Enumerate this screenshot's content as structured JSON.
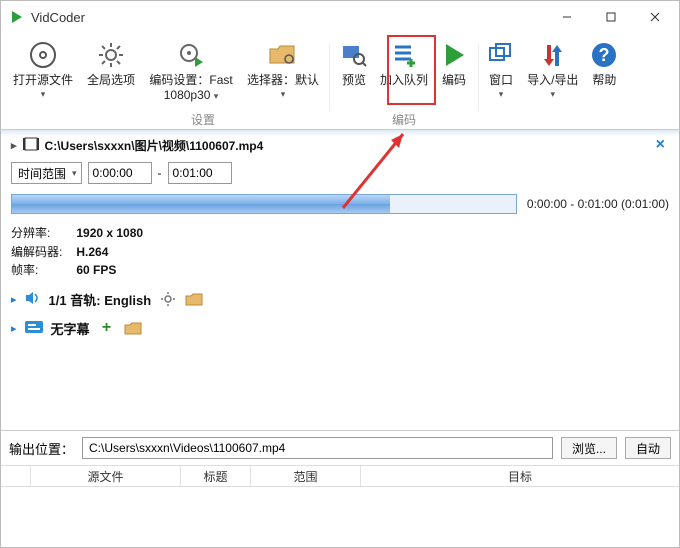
{
  "window": {
    "title": "VidCoder"
  },
  "toolbar": {
    "open_source": "打开源文件",
    "global_opts": "全局选项",
    "encode_settings_l1": "编码设置：Fast",
    "encode_settings_l2": "1080p30",
    "picker_l1": "选择器：默认",
    "preview": "预览",
    "add_queue": "加入队列",
    "encode": "编码",
    "window": "窗口",
    "import_export": "导入/导出",
    "help": "帮助",
    "group_settings": "设置",
    "group_encode": "编码"
  },
  "source": {
    "path": "C:\\Users\\sxxxn\\图片\\视频\\1100607.mp4",
    "range_mode": "时间范围",
    "start_time": "0:00:00",
    "end_time": "0:01:00",
    "dash": "-",
    "progress_text": "0:00:00 - 0:01:00   (0:01:00)"
  },
  "meta": {
    "res_label": "分辨率:",
    "res_value": "1920 x 1080",
    "codec_label": "编解码器:",
    "codec_value": "H.264",
    "fps_label": "帧率:",
    "fps_value": "60 FPS"
  },
  "audio": {
    "count": "1/1",
    "label": "音轨:",
    "track": "English"
  },
  "subs": {
    "label": "无字幕"
  },
  "output": {
    "label": "输出位置：",
    "path": "C:\\Users\\sxxxn\\Videos\\1100607.mp4",
    "browse": "浏览...",
    "auto": "自动"
  },
  "grid": {
    "col_source": "源文件",
    "col_title": "标题",
    "col_range": "范围",
    "col_target": "目标"
  }
}
